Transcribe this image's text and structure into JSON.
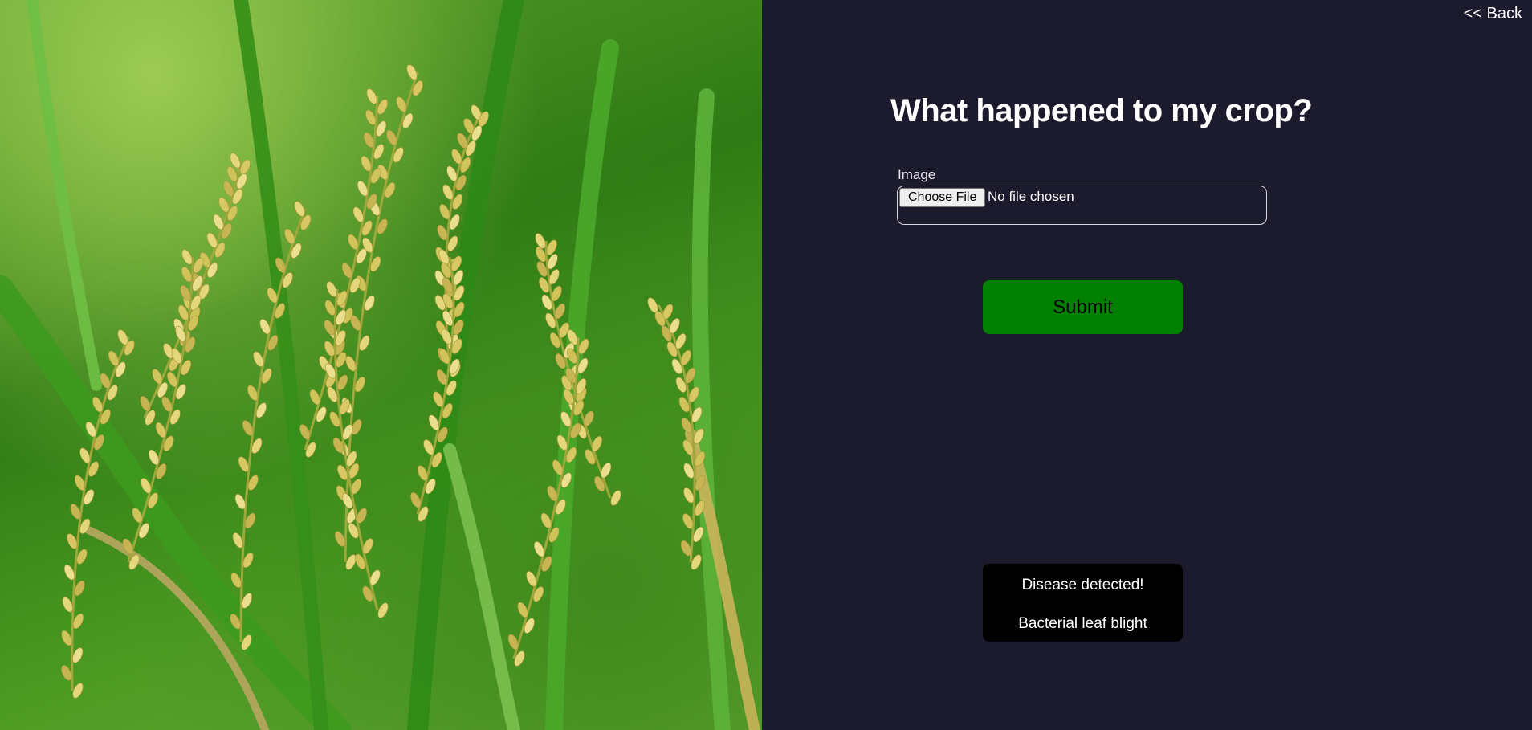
{
  "nav": {
    "back_label": "<< Back"
  },
  "hero_image": {
    "description_icon": "rice-crop-photo"
  },
  "form": {
    "title": "What happened to my crop?",
    "image_label": "Image",
    "choose_file_label": "Choose File",
    "file_status": "No file chosen",
    "submit_label": "Submit"
  },
  "result": {
    "heading": "Disease detected!",
    "disease": "Bacterial leaf blight"
  },
  "colors": {
    "panel_background": "#1c1b2e",
    "submit_background": "#008000",
    "result_background": "#000000",
    "text": "#ffffff"
  }
}
